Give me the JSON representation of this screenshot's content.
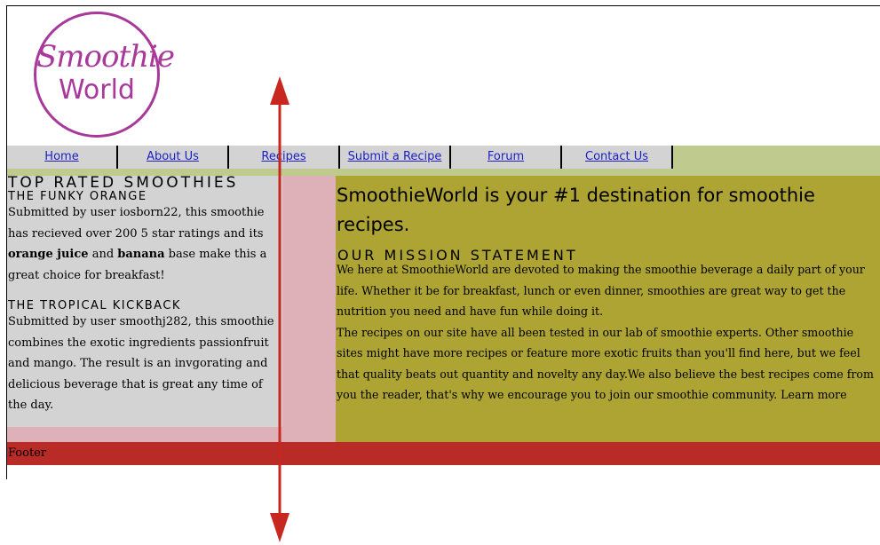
{
  "logo": {
    "line1": "Smoothie",
    "line2": "World",
    "color": "#a8389a"
  },
  "nav": {
    "items": [
      {
        "label": "Home"
      },
      {
        "label": "About Us"
      },
      {
        "label": "Recipes"
      },
      {
        "label": "Submit a Recipe"
      },
      {
        "label": "Forum"
      },
      {
        "label": "Contact Us"
      }
    ],
    "link_color": "#1c1ec6"
  },
  "sidebar": {
    "heading": "TOP RATED SMOOTHIES",
    "smoothies": [
      {
        "title": "THE FUNKY ORANGE",
        "text_before": "Submitted by user iosborn22, this smoothie has recieved over 200 5 star ratings and its ",
        "bold1": "orange juice",
        "text_mid": " and ",
        "bold2": "banana",
        "text_after": " base make this a great choice for breakfast!"
      },
      {
        "title": "THE TROPICAL KICKBACK",
        "text": "Submitted by user smoothj282, this smoothie combines the exotic ingredients passionfruit and mango. The result is an invgorating and delicious beverage that is great any time of the day."
      }
    ]
  },
  "main": {
    "title": "SmoothieWorld is your #1 destination for smoothie recipes.",
    "mission_heading": "OUR MISSION STATEMENT",
    "paragraph1": "We here at SmoothieWorld are devoted to making the smoothie beverage a daily part of your life. Whether it be for breakfast, lunch or even dinner, smoothies are great way to get the nutrition you need and have fun while doing it.",
    "paragraph2": "The recipes on our site have all been tested in our lab of smoothie experts. Other smoothie sites might have more recipes or feature more exotic fruits than you'll find here, but we feel that quality beats out quantity and novelty any day.We also believe the best recipes come from you the reader, that's why we encourage you to join our smoothie community. Learn more"
  },
  "footer": {
    "label": "Footer"
  },
  "colors": {
    "nav_bg": "#bfcb8e",
    "sidebar_bg": "#d3d3d3",
    "sidebar_column_bg": "#deb0b8",
    "main_bg": "#aea433",
    "footer_bg": "#b82b27",
    "arrow": "#c8271f"
  }
}
